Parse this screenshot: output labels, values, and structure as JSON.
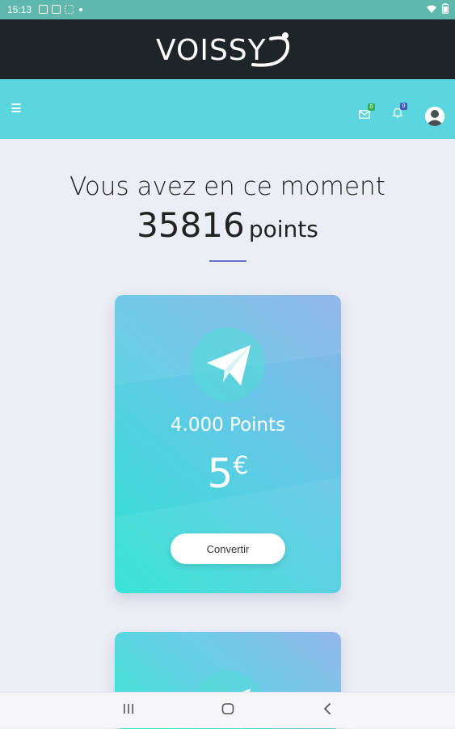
{
  "status_bar": {
    "time": "15:13",
    "left_icons": [
      "image-icon",
      "screen-icon",
      "grid-icon",
      "dot-icon"
    ],
    "right_icons": [
      "wifi-icon",
      "battery-icon"
    ]
  },
  "brand": {
    "logo_text": "VOISSY",
    "colors": {
      "brand_bar": "#1e2528",
      "nav_bar": "#5bd6df",
      "accent_divider": "#6a73c9"
    }
  },
  "nav": {
    "menu_icon": "hamburger-icon",
    "mail_badge": "0",
    "notification_badge": "0",
    "mail_badge_color": "#2bb24c",
    "notification_badge_color": "#4a55c8"
  },
  "main": {
    "headline": "Vous avez en ce moment",
    "points_value": "35816",
    "points_unit": "points"
  },
  "cards": [
    {
      "icon": "paper-plane-icon",
      "points_label": "4.000 Points",
      "value": "5",
      "currency": "€",
      "button_label": "Convertir"
    },
    {
      "icon": "paper-plane-icon"
    }
  ],
  "bottom_nav": {
    "buttons": [
      "recent-apps-icon",
      "home-icon",
      "back-icon"
    ]
  }
}
